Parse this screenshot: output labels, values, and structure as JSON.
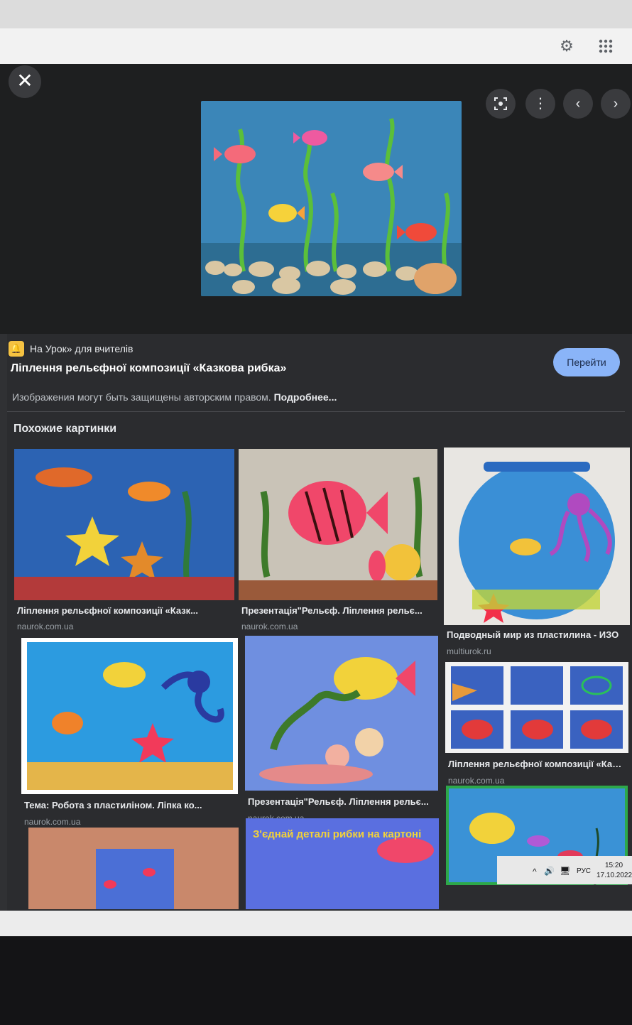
{
  "browser": {
    "settings_icon": "gear-icon",
    "apps_icon": "grid-icon"
  },
  "viewer": {
    "close_icon": "close-icon",
    "lens_icon": "lens-icon",
    "more_icon": "more-vert-icon",
    "prev_icon": "chevron-left-icon",
    "next_icon": "chevron-right-icon"
  },
  "result": {
    "source": "На Урок» для вчителів",
    "title": "Ліплення рельєфної композиції «Казкова рибка»",
    "go_button": "Перейти",
    "copyright": "Изображения могут быть защищены авторским правом.",
    "more_link": "Подробнее..."
  },
  "similar": {
    "heading": "Похожие картинки",
    "items": [
      {
        "caption": "Ліплення рельєфної композиції «Казк...",
        "domain": "naurok.com.ua"
      },
      {
        "caption": "Презентація\"Рельєф. Ліплення рельє...",
        "domain": "naurok.com.ua"
      },
      {
        "caption": "Подводный мир из пластилина - ИЗО",
        "domain": "multiurok.ru"
      },
      {
        "caption": "Тема: Робота з пластиліном. Ліпка ко...",
        "domain": "naurok.com.ua"
      },
      {
        "caption": "Презентація\"Рельєф. Ліплення рельє...",
        "domain": "naurok.com.ua"
      },
      {
        "caption": "Ліплення рельєфної композиції «Казк...",
        "domain": "naurok.com.ua"
      },
      {
        "caption": "",
        "domain": ""
      },
      {
        "caption": "З'єднай деталі рибки на картоні",
        "domain": ""
      },
      {
        "caption": "",
        "domain": ""
      }
    ]
  },
  "taskbar": {
    "lang": "РУС",
    "time": "15:20",
    "date": "17.10.2022"
  }
}
